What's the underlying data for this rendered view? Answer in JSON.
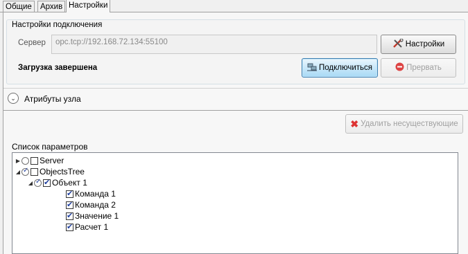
{
  "tabs": [
    {
      "label": "Общие"
    },
    {
      "label": "Архив"
    },
    {
      "label": "Настройки"
    }
  ],
  "connection": {
    "group_title": "Настройки подключения",
    "server_label": "Сервер",
    "server_value": "opc.tcp://192.168.72.134:55100",
    "settings_button": "Настройки",
    "status": "Загрузка завершена",
    "connect_button": "Подключиться",
    "abort_button": "Прервать"
  },
  "node_attributes": {
    "expander_label": "Атрибуты узла"
  },
  "parameters": {
    "delete_button": "Удалить несуществующие",
    "list_label": "Список параметров",
    "tree": [
      {
        "label": "Server",
        "checked": false,
        "radio": false
      },
      {
        "label": "ObjectsTree",
        "checked": false,
        "radio": true
      },
      {
        "label": "Объект 1",
        "checked": true,
        "radio": true
      },
      {
        "label": "Команда 1",
        "checked": true
      },
      {
        "label": "Команда 2",
        "checked": true
      },
      {
        "label": "Значение 1",
        "checked": true
      },
      {
        "label": "Расчет 1",
        "checked": true
      }
    ]
  }
}
